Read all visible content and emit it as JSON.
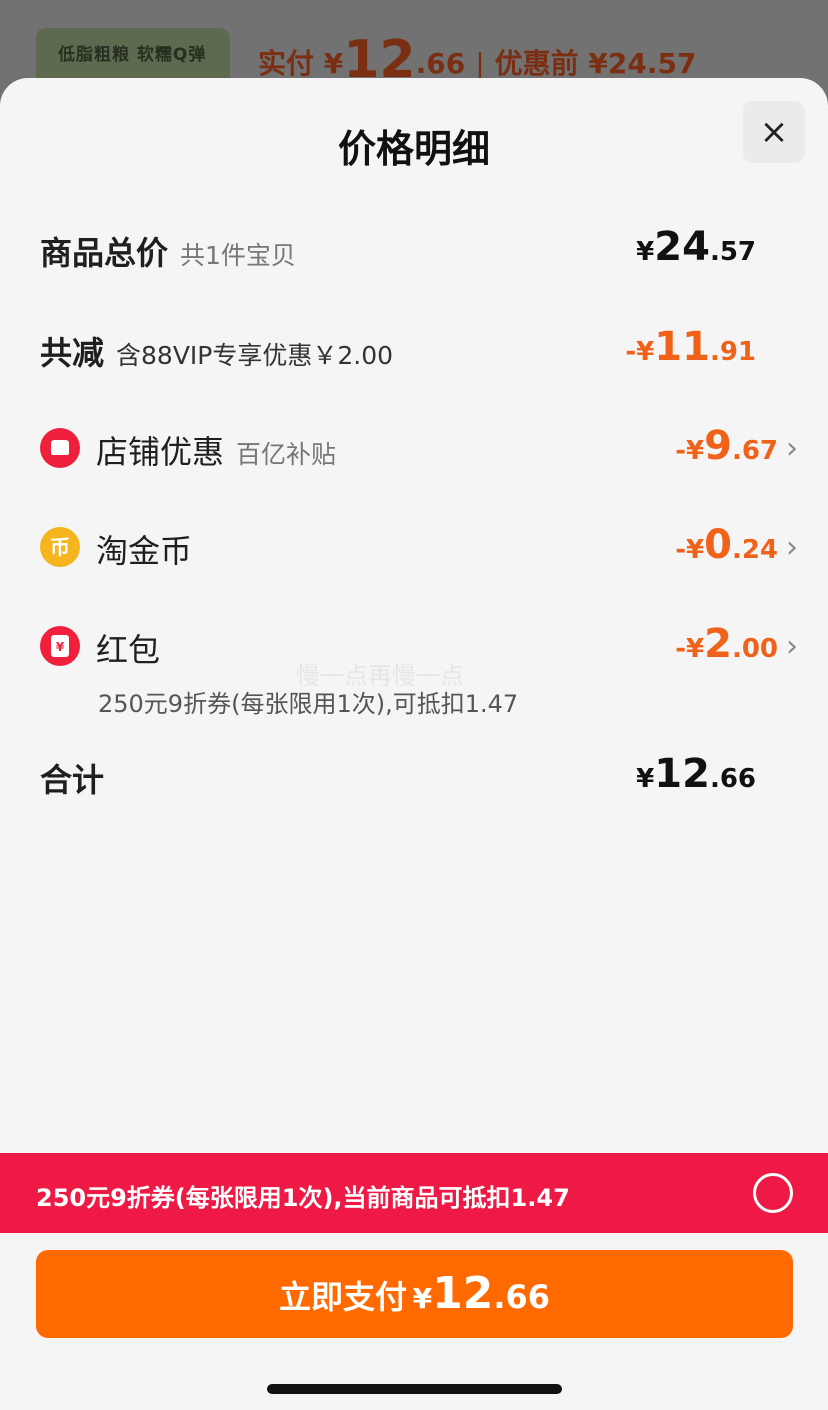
{
  "background": {
    "product_tag": "低脂粗粮 软糯Q弹",
    "paid_label": "实付 ¥",
    "paid_int": "12",
    "paid_dec": ".66",
    "separator": "|",
    "before_discount": "优惠前 ¥24.57"
  },
  "sheet": {
    "title": "价格明细",
    "close_icon": "×"
  },
  "rows": {
    "total": {
      "label": "商品总价",
      "sub": "共1件宝贝",
      "yen": "¥",
      "int": "24",
      "dec": ".57"
    },
    "reduction": {
      "label": "共减",
      "sub": "含88VIP专享优惠￥2.00",
      "yen": "-¥",
      "int": "11",
      "dec": ".91"
    },
    "shop": {
      "label": "店铺优惠",
      "sub": "百亿补贴",
      "yen": "-¥",
      "int": "9",
      "dec": ".67"
    },
    "coins": {
      "label": "淘金币",
      "icon_glyph": "币",
      "yen": "-¥",
      "int": "0",
      "dec": ".24"
    },
    "hongbao": {
      "label": "红包",
      "icon_glyph": "¥",
      "yen": "-¥",
      "int": "2",
      "dec": ".00",
      "note": "250元9折券(每张限用1次),可抵扣1.47"
    },
    "sum": {
      "label": "合计",
      "yen": "¥",
      "int": "12",
      "dec": ".66"
    }
  },
  "watermark": "慢一点再慢一点",
  "coupon_bar": {
    "text": "250元9折券(每张限用1次),当前商品可抵扣1.47"
  },
  "pay_button": {
    "label": "立即支付",
    "yen": "¥",
    "int": "12",
    "dec": ".66"
  },
  "colors": {
    "accent_orange": "#ff6a00",
    "discount_orange": "#f0621a",
    "coupon_red": "#ee1944"
  },
  "icons": {
    "chevron": "›"
  }
}
